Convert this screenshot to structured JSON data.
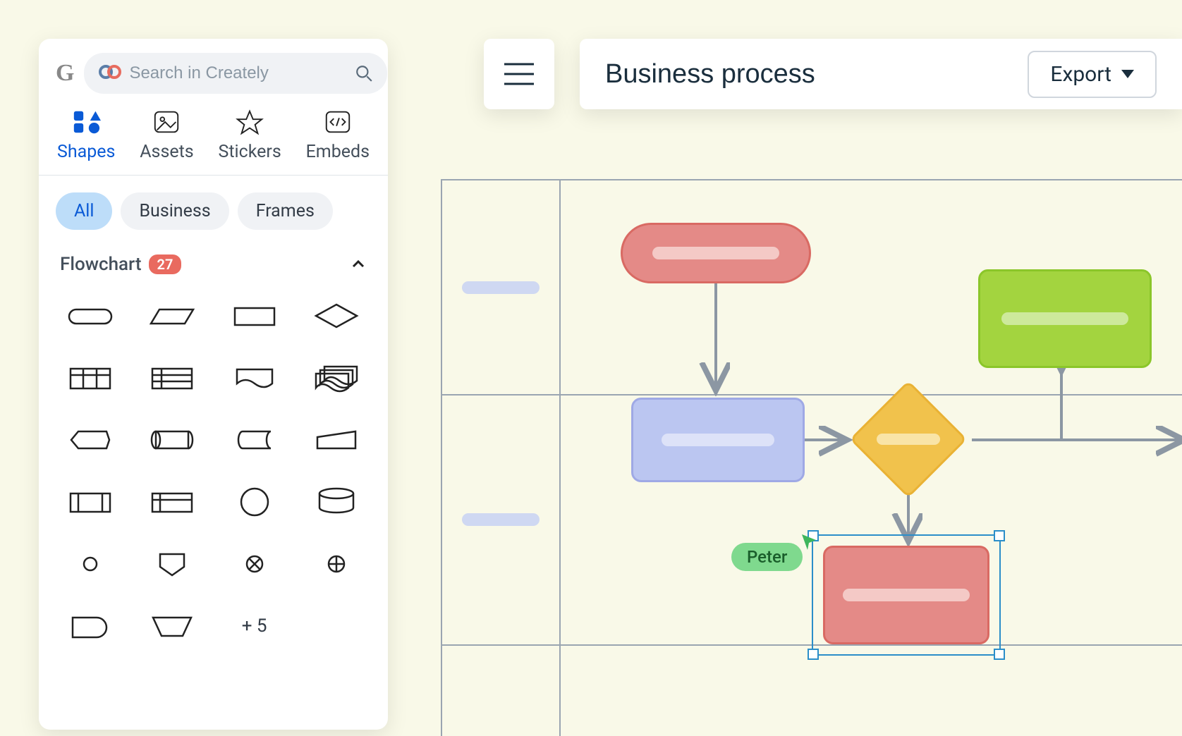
{
  "search": {
    "placeholder": "Search in Creately"
  },
  "tabs": [
    {
      "label": "Shapes"
    },
    {
      "label": "Assets"
    },
    {
      "label": "Stickers"
    },
    {
      "label": "Embeds"
    }
  ],
  "filters": [
    {
      "label": "All"
    },
    {
      "label": "Business"
    },
    {
      "label": "Frames"
    }
  ],
  "section": {
    "title": "Flowchart",
    "count": "27",
    "more": "+ 5"
  },
  "document": {
    "title": "Business process",
    "export_label": "Export"
  },
  "collaborator": {
    "name": "Peter"
  },
  "colors": {
    "red_fill": "#e48a87",
    "red_border": "#d96a63",
    "red_bar": "#f4c9c6",
    "blue_fill": "#bbc6f1",
    "blue_border": "#9fa9e5",
    "blue_bar": "#dde2f8",
    "yellow_fill": "#f1c24c",
    "yellow_border": "#e9b234",
    "yellow_bar": "#f9e4a7",
    "green_fill": "#a3d43f",
    "green_border": "#8bc62a",
    "green_bar": "#cde99b"
  }
}
